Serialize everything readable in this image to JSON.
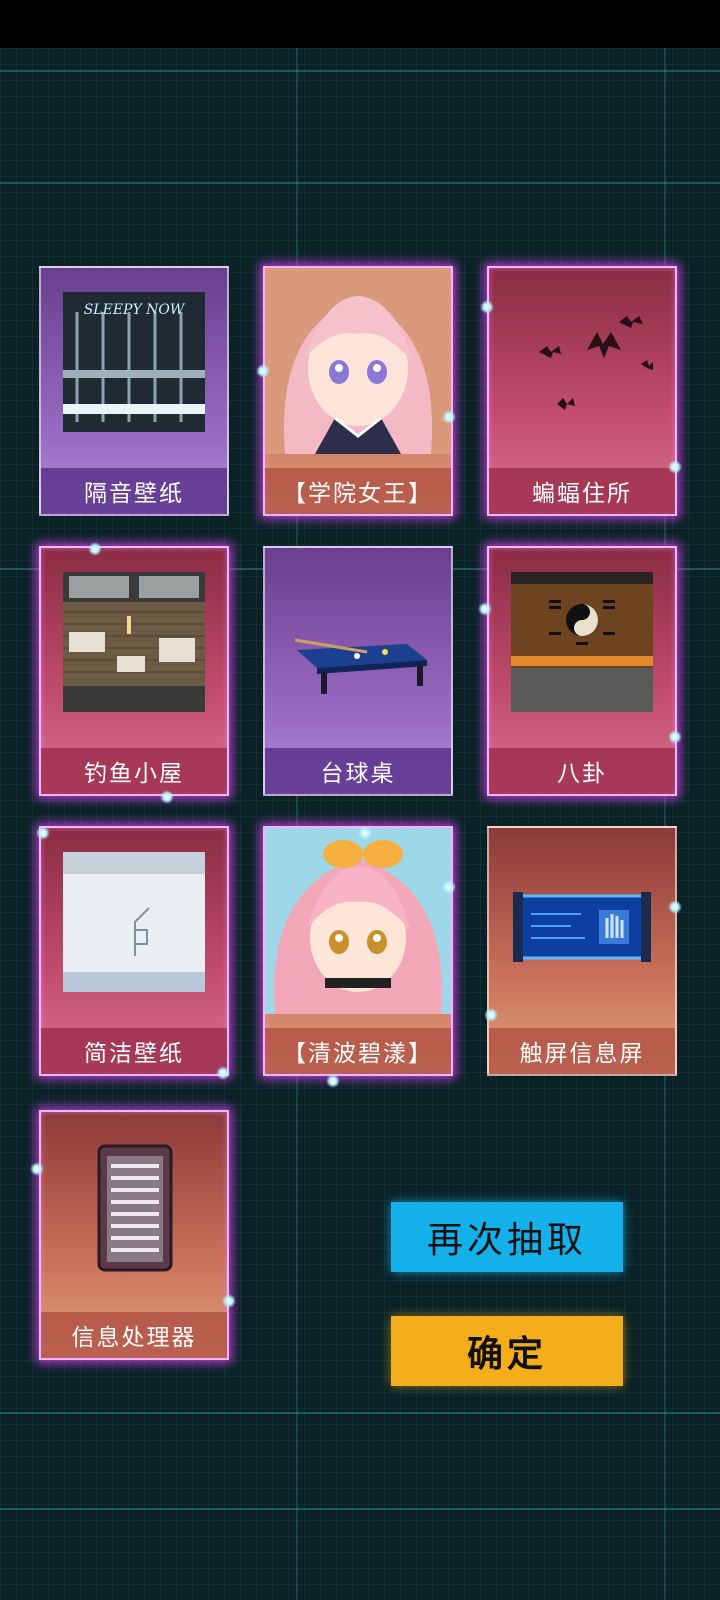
{
  "cards": [
    {
      "label": "隔音壁纸",
      "rarity_color": "purple",
      "icon": "soundproof-wallpaper-icon"
    },
    {
      "label": "【学院女王】",
      "rarity_color": "orange",
      "icon": "pink-hair-girl-portrait"
    },
    {
      "label": "蝙蝠住所",
      "rarity_color": "red",
      "icon": "bats-icon"
    },
    {
      "label": "钓鱼小屋",
      "rarity_color": "red",
      "icon": "fishing-hut-icon"
    },
    {
      "label": "台球桌",
      "rarity_color": "purple",
      "icon": "pool-table-icon"
    },
    {
      "label": "八卦",
      "rarity_color": "red",
      "icon": "bagua-icon"
    },
    {
      "label": "简洁壁纸",
      "rarity_color": "red",
      "icon": "simple-wallpaper-icon"
    },
    {
      "label": "【清波碧漾】",
      "rarity_color": "orange",
      "icon": "swimsuit-girl-portrait"
    },
    {
      "label": "触屏信息屏",
      "rarity_color": "orange",
      "icon": "touch-screen-icon"
    },
    {
      "label": "信息处理器",
      "rarity_color": "orange",
      "icon": "server-rack-icon"
    }
  ],
  "wallpaper_sign_text": "SLEEPY NOW",
  "buttons": {
    "redraw": "再次抽取",
    "confirm": "确定"
  },
  "colors": {
    "redraw_button": "#13b0ea",
    "confirm_button": "#f4ae1b",
    "glow": "#e646ff"
  }
}
